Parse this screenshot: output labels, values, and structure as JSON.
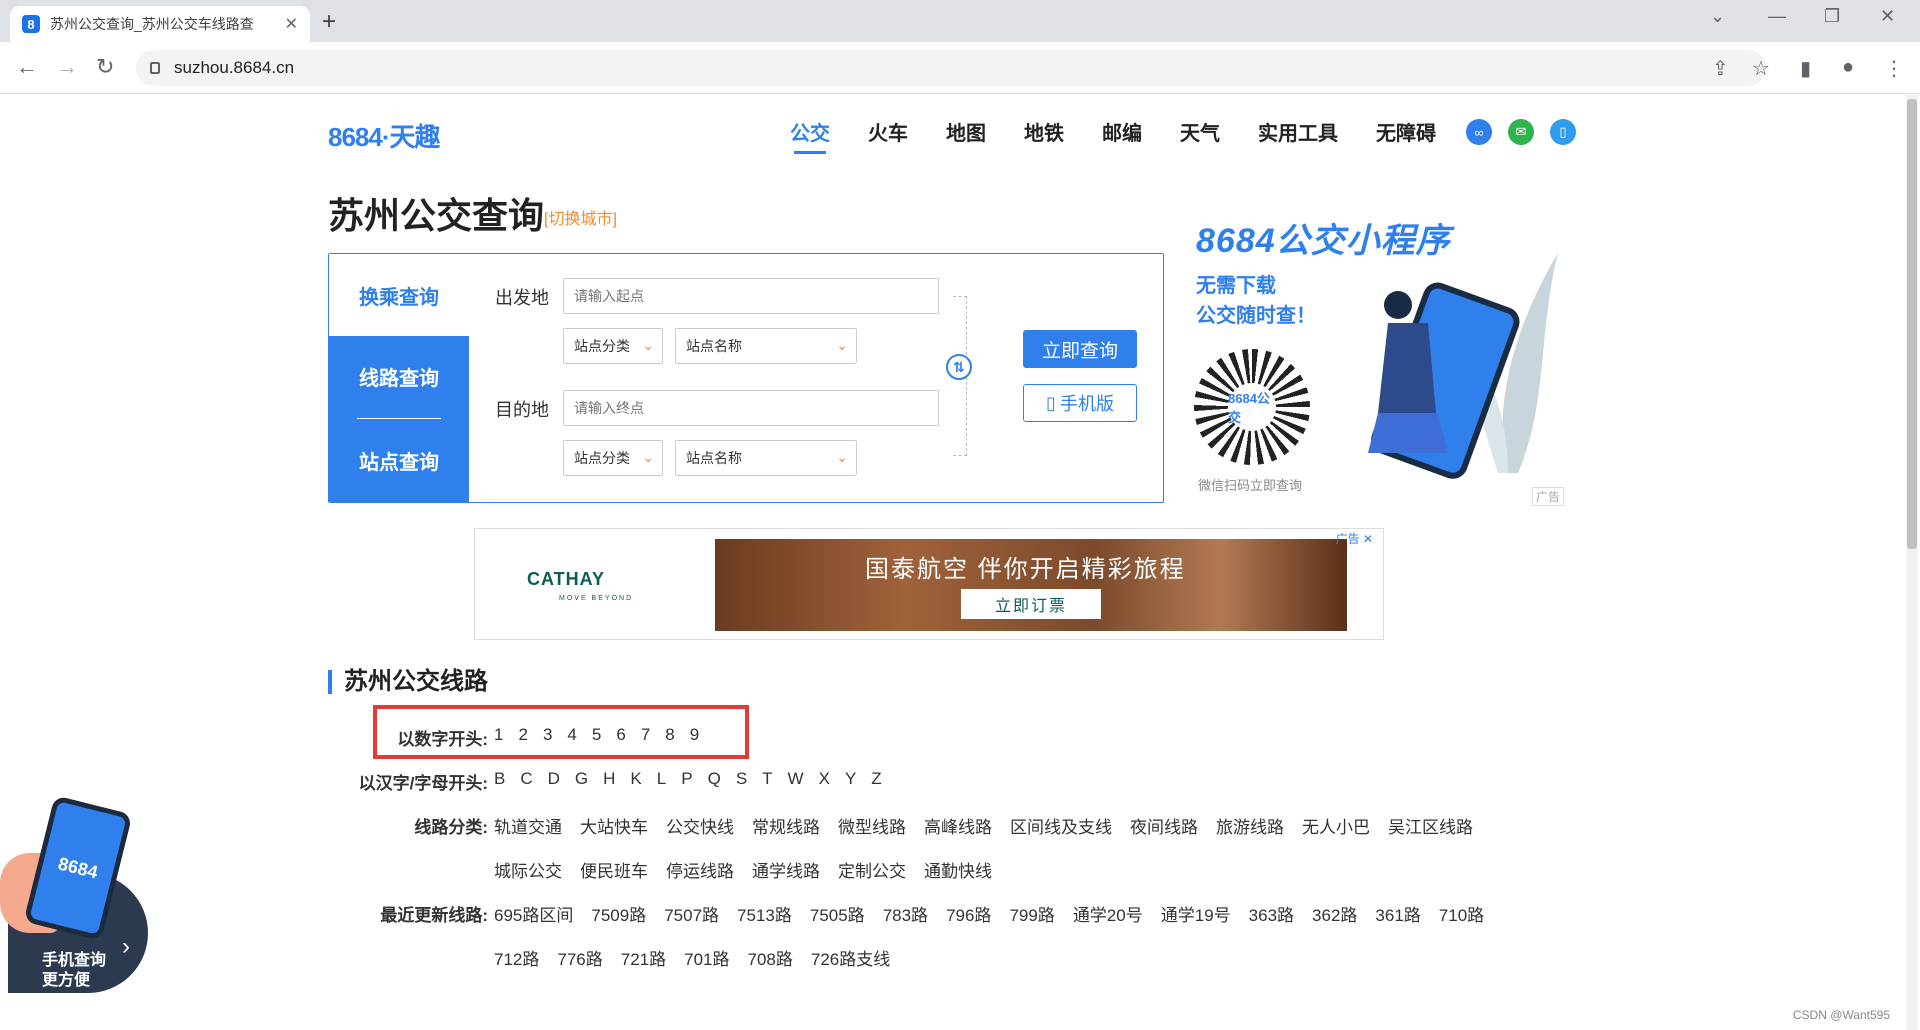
{
  "browser": {
    "tab_title": "苏州公交查询_苏州公交车线路查",
    "favicon": "8",
    "url": "suzhou.8684.cn",
    "new_tab": "+",
    "close": "✕"
  },
  "header": {
    "logo": "8684·天趣",
    "nav": [
      "公交",
      "火车",
      "地图",
      "地铁",
      "邮编",
      "天气",
      "实用工具",
      "无障碍"
    ]
  },
  "title": {
    "main": "苏州公交查询",
    "switch_city": "[切换城市]"
  },
  "search": {
    "tabs": [
      "换乘查询",
      "线路查询",
      "站点查询"
    ],
    "from_label": "出发地",
    "from_placeholder": "请输入起点",
    "to_label": "目的地",
    "to_placeholder": "请输入终点",
    "category": "站点分类",
    "station": "站点名称",
    "submit": "立即查询",
    "mobile": "手机版"
  },
  "mini_program_ad": {
    "title": "8684公交小程序",
    "line1": "无需下载",
    "line2": "公交随时查！",
    "qr_label": "8684公交",
    "caption": "微信扫码立即查询",
    "ad": "广告"
  },
  "banner_ad": {
    "brand": "CATHAY",
    "brand_sub": "MOVE BEYOND",
    "slogan": "国泰航空 伴你开启精彩旅程",
    "button": "立即订票",
    "ad": "广告"
  },
  "lines": {
    "section_title": "苏州公交线路",
    "digit_label": "以数字开头:",
    "digits": [
      "1",
      "2",
      "3",
      "4",
      "5",
      "6",
      "7",
      "8",
      "9"
    ],
    "alpha_label": "以汉字/字母开头:",
    "letters": [
      "B",
      "C",
      "D",
      "G",
      "H",
      "K",
      "L",
      "P",
      "Q",
      "S",
      "T",
      "W",
      "X",
      "Y",
      "Z"
    ],
    "category_label": "线路分类:",
    "categories_row1": [
      "轨道交通",
      "大站快车",
      "公交快线",
      "常规线路",
      "微型线路",
      "高峰线路",
      "区间线及支线",
      "夜间线路",
      "旅游线路",
      "无人小巴",
      "吴江区线路"
    ],
    "categories_row2": [
      "城际公交",
      "便民班车",
      "停运线路",
      "通学线路",
      "定制公交",
      "通勤快线"
    ],
    "recent_label": "最近更新线路:",
    "recent_row1": [
      "695路区间",
      "7509路",
      "7507路",
      "7513路",
      "7505路",
      "783路",
      "796路",
      "799路",
      "通学20号",
      "通学19号",
      "363路",
      "362路",
      "361路",
      "710路"
    ],
    "recent_row2": [
      "712路",
      "776路",
      "721路",
      "701路",
      "708路",
      "726路支线"
    ]
  },
  "floating": {
    "phone_label": "8684",
    "line1": "手机查询",
    "line2": "更方便",
    "arrow": "›"
  },
  "watermark": "CSDN @Want595"
}
